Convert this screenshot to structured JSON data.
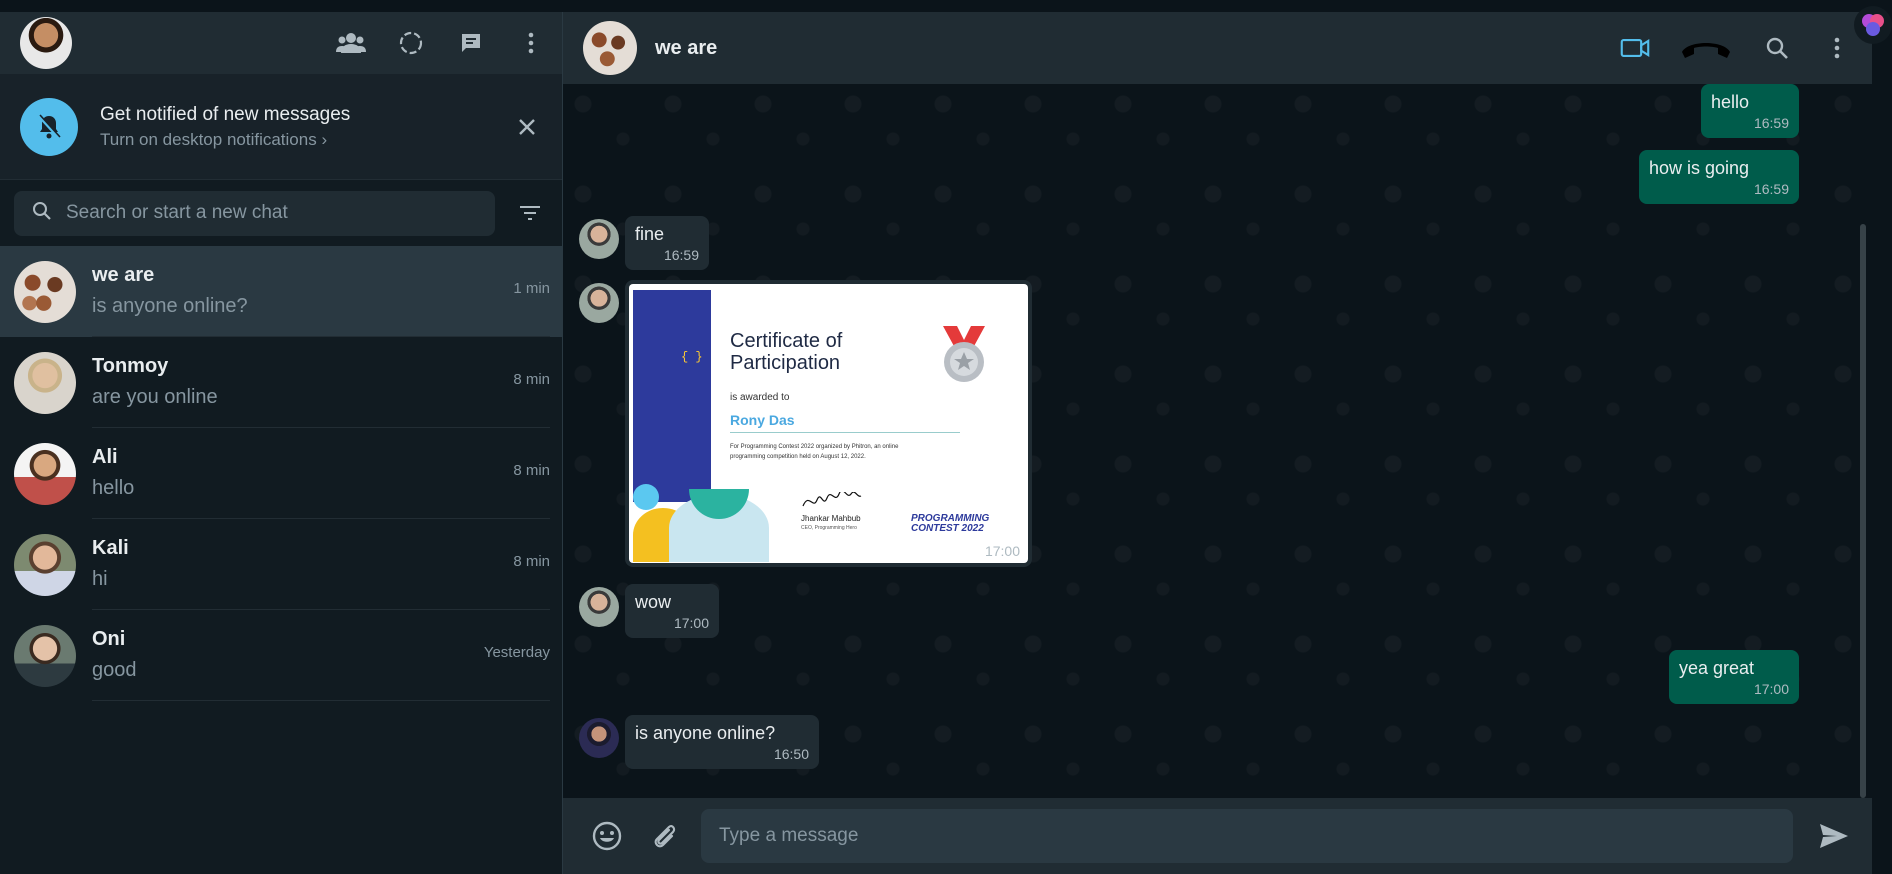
{
  "notification": {
    "title": "Get notified of new messages",
    "subtitle": "Turn on desktop notifications ›"
  },
  "search": {
    "placeholder": "Search or start a new chat"
  },
  "chats": [
    {
      "name": "we are",
      "last": "is anyone online?",
      "time": "1 min",
      "avatar_color": "#c8b8a8"
    },
    {
      "name": "Tonmoy",
      "last": "are you online",
      "time": "8 min",
      "avatar_color": "#a9a49c"
    },
    {
      "name": "Ali",
      "last": "hello",
      "time": "8 min",
      "avatar_color": "#b35a4a"
    },
    {
      "name": "Kali",
      "last": "hi",
      "time": "8 min",
      "avatar_color": "#7c8a7c"
    },
    {
      "name": "Oni",
      "last": "good",
      "time": "Yesterday",
      "avatar_color": "#3d4a44"
    }
  ],
  "conversation": {
    "title": "we are",
    "messages": [
      {
        "dir": "out",
        "text": "hello",
        "time": "16:59"
      },
      {
        "dir": "out",
        "text": "how is going",
        "time": "16:59"
      },
      {
        "dir": "in",
        "text": "fine",
        "time": "16:59"
      },
      {
        "dir": "in",
        "type": "image",
        "time": "17:00"
      },
      {
        "dir": "in",
        "text": "wow",
        "time": "17:00"
      },
      {
        "dir": "out",
        "text": "yea great",
        "time": "17:00"
      },
      {
        "dir": "in",
        "text": "is anyone online?",
        "time": "16:50"
      }
    ]
  },
  "certificate": {
    "title_line1": "Certificate of",
    "title_line2": "Participation",
    "awarded": "is awarded to",
    "name": "Rony Das",
    "desc": "For Programming Contest 2022 organized by Phitron, an online programming competition held on August 12, 2022.",
    "signer": "Jhankar Mahbub",
    "signer_role": "CEO, Programming Hero",
    "contest_line1": "PROGRAMMING",
    "contest_line2": "CONTEST 2022"
  },
  "composer": {
    "placeholder": "Type a message"
  },
  "colors": {
    "accent": "#00a884",
    "outgoing": "#005c4b",
    "incoming": "#202c33",
    "notif": "#53bdeb",
    "video": "#53bdeb"
  }
}
